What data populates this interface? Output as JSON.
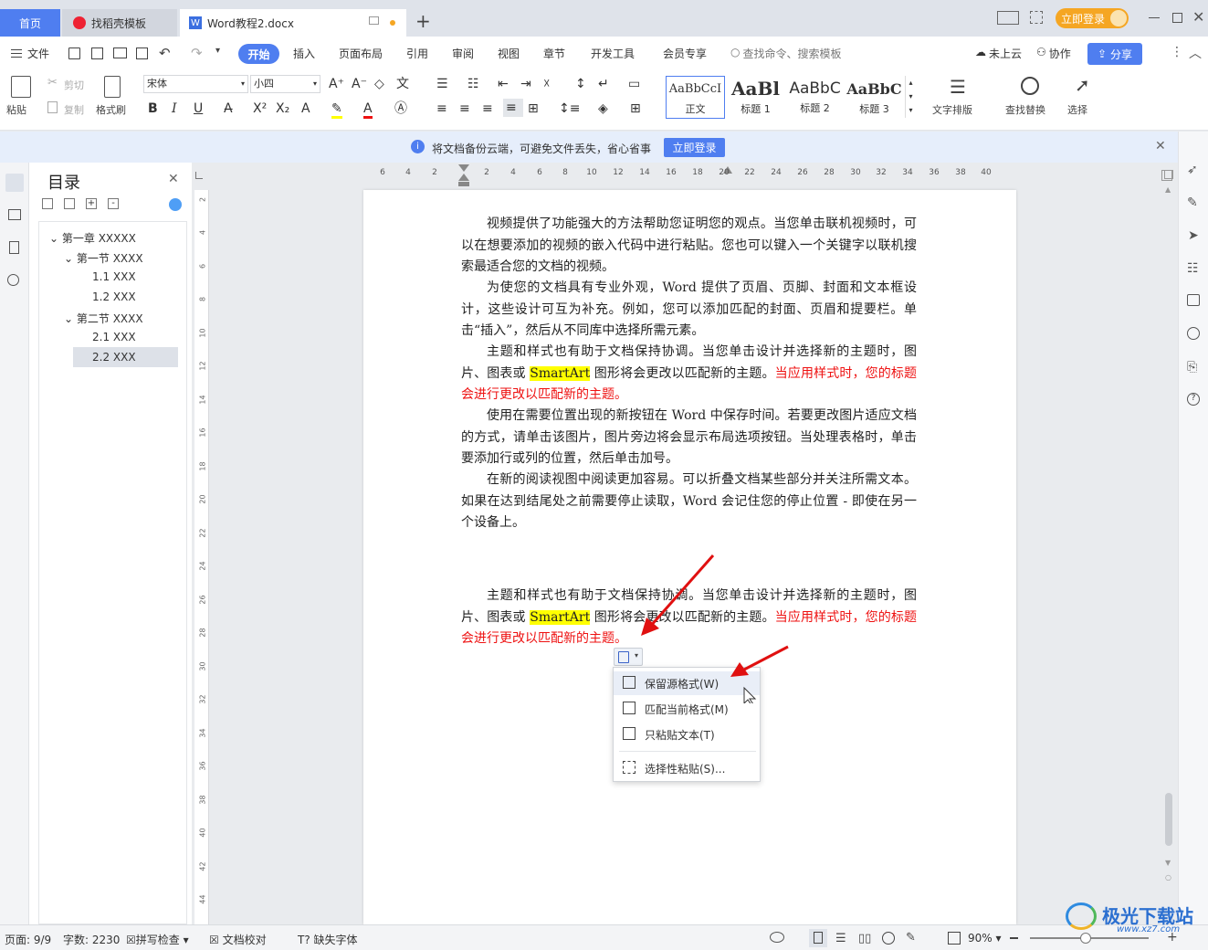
{
  "tabs": {
    "home": "首页",
    "template": "找稻壳模板",
    "doc": "Word教程2.docx",
    "login": "立即登录"
  },
  "menu": {
    "file": "文件",
    "items": [
      "开始",
      "插入",
      "页面布局",
      "引用",
      "审阅",
      "视图",
      "章节",
      "开发工具",
      "会员专享"
    ],
    "search_placeholder": "查找命令、搜索模板",
    "cloud": "未上云",
    "collab": "协作",
    "share": "分享"
  },
  "ribbon": {
    "paste": "粘贴",
    "cut": "剪切",
    "copy": "复制",
    "format_painter": "格式刷",
    "font_name": "宋体",
    "font_size": "小四",
    "styles": [
      {
        "preview": "AaBbCcI",
        "name": "正文"
      },
      {
        "preview": "AaBl",
        "name": "标题 1"
      },
      {
        "preview": "AaBbC",
        "name": "标题 2"
      },
      {
        "preview": "AaBbC",
        "name": "标题 3"
      }
    ],
    "text_layout": "文字排版",
    "find_replace": "查找替换",
    "select": "选择"
  },
  "notice": {
    "text": "将文档备份云端，可避免文件丢失，省心省事",
    "button": "立即登录"
  },
  "toc": {
    "title": "目录",
    "items": [
      "第一章 XXXXX",
      "第一节 XXXX",
      "1.1 XXX",
      "1.2 XXX",
      "第二节 XXXX",
      "2.1 XXX",
      "2.2 XXX"
    ]
  },
  "ruler": {
    "h": [
      "6",
      "4",
      "2",
      "",
      "2",
      "4",
      "6",
      "8",
      "10",
      "12",
      "14",
      "16",
      "18",
      "20",
      "22",
      "24",
      "26",
      "28",
      "30",
      "32",
      "34",
      "36",
      "38",
      "40"
    ],
    "v": [
      "2",
      "4",
      "6",
      "8",
      "10",
      "12",
      "14",
      "16",
      "18",
      "20",
      "22",
      "24",
      "26",
      "28",
      "30",
      "32",
      "34",
      "36",
      "38",
      "40",
      "42",
      "44"
    ]
  },
  "document": {
    "p1": "视频提供了功能强大的方法帮助您证明您的观点。当您单击联机视频时，可以在想要添加的视频的嵌入代码中进行粘贴。您也可以键入一个关键字以联机搜索最适合您的文档的视频。",
    "p2": "为使您的文档具有专业外观，Word 提供了页眉、页脚、封面和文本框设计，这些设计可互为补充。例如，您可以添加匹配的封面、页眉和提要栏。单击“插入”，然后从不同库中选择所需元素。",
    "p3_a": "主题和样式也有助于文档保持协调。当您单击设计并选择新的主题时，图片、图表或 ",
    "p3_hl": "SmartArt",
    "p3_b": " 图形将会更改以匹配新的主题。",
    "p3_red": "当应用样式时，您的标题会进行更改以匹配新的主题。",
    "p4": "使用在需要位置出现的新按钮在 Word 中保存时间。若要更改图片适应文档的方式，请单击该图片，图片旁边将会显示布局选项按钮。当处理表格时，单击要添加行或列的位置，然后单击加号。",
    "p5": "在新的阅读视图中阅读更加容易。可以折叠文档某些部分并关注所需文本。如果在达到结尾处之前需要停止读取，Word 会记住您的停止位置 - 即使在另一个设备上。",
    "p6_a": "主题和样式也有助于文档保持协调。当您单击设计并选择新的主题时，图片、图表或 ",
    "p6_hl": "SmartArt",
    "p6_b": " 图形将会更改以匹配新的主题。",
    "p6_red": "当应用样式时，您的标题会进行更改以匹配新的主题。"
  },
  "paste_menu": {
    "keep_source": "保留源格式(W)",
    "match_current": "匹配当前格式(M)",
    "text_only": "只粘贴文本(T)",
    "selective": "选择性粘贴(S)..."
  },
  "status": {
    "page": "页面: 9/9",
    "words": "字数: 2230",
    "spell": "拼写检查",
    "proof": "文档校对",
    "missing_font": "缺失字体",
    "zoom": "90%"
  },
  "watermark": "极光下载站",
  "watermark_url": "www.xz7.com",
  "colors": {
    "accent": "#4f7ef0",
    "login": "#f5a623",
    "highlight": "#ffff00",
    "red_text": "#ee1111",
    "arrow": "#e01010"
  }
}
